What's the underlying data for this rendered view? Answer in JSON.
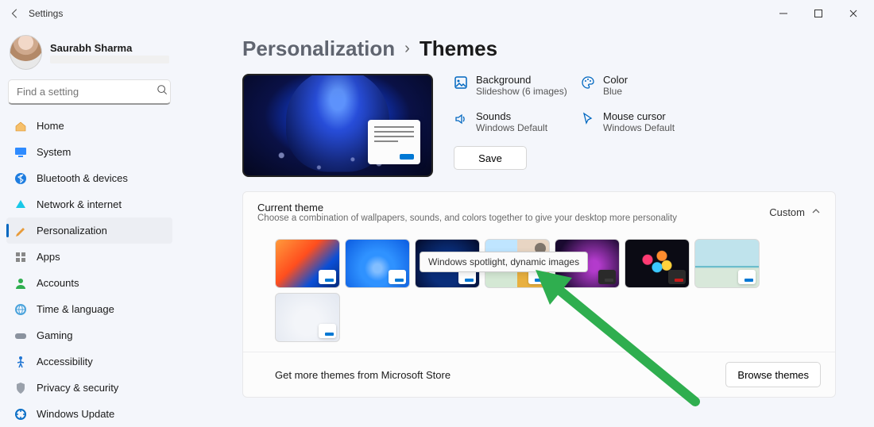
{
  "window": {
    "title": "Settings",
    "controls": [
      "minimize",
      "maximize",
      "close"
    ]
  },
  "user": {
    "name": "Saurabh Sharma"
  },
  "search": {
    "placeholder": "Find a setting"
  },
  "sidebar": {
    "items": [
      {
        "icon": "home",
        "label": "Home",
        "color": "#f4a22e"
      },
      {
        "icon": "monitor",
        "label": "System",
        "color": "#1e90ff"
      },
      {
        "icon": "bluetooth",
        "label": "Bluetooth & devices",
        "color": "#1e7de0"
      },
      {
        "icon": "wifi",
        "label": "Network & internet",
        "color": "#19b9d8"
      },
      {
        "icon": "brush",
        "label": "Personalization",
        "color": "#e68619",
        "active": true
      },
      {
        "icon": "apps",
        "label": "Apps",
        "color": "#7a7e86"
      },
      {
        "icon": "person",
        "label": "Accounts",
        "color": "#2fae4f"
      },
      {
        "icon": "globe",
        "label": "Time & language",
        "color": "#4aa3dc"
      },
      {
        "icon": "gamepad",
        "label": "Gaming",
        "color": "#7c8594"
      },
      {
        "icon": "access",
        "label": "Accessibility",
        "color": "#1e74d2"
      },
      {
        "icon": "shield",
        "label": "Privacy & security",
        "color": "#8d949e"
      },
      {
        "icon": "update",
        "label": "Windows Update",
        "color": "#0b6fc6"
      }
    ]
  },
  "breadcrumb": {
    "parent": "Personalization",
    "current": "Themes"
  },
  "summary": {
    "background": {
      "label": "Background",
      "value": "Slideshow (6 images)"
    },
    "color": {
      "label": "Color",
      "value": "Blue"
    },
    "sounds": {
      "label": "Sounds",
      "value": "Windows Default"
    },
    "cursor": {
      "label": "Mouse cursor",
      "value": "Windows Default"
    },
    "save": "Save"
  },
  "current_theme": {
    "label": "Current theme",
    "desc": "Choose a combination of wallpapers, sounds, and colors together to give your desktop more personality",
    "value": "Custom",
    "tooltip": "Windows spotlight, dynamic images"
  },
  "store": {
    "label": "Get more themes from Microsoft Store",
    "button": "Browse themes"
  }
}
